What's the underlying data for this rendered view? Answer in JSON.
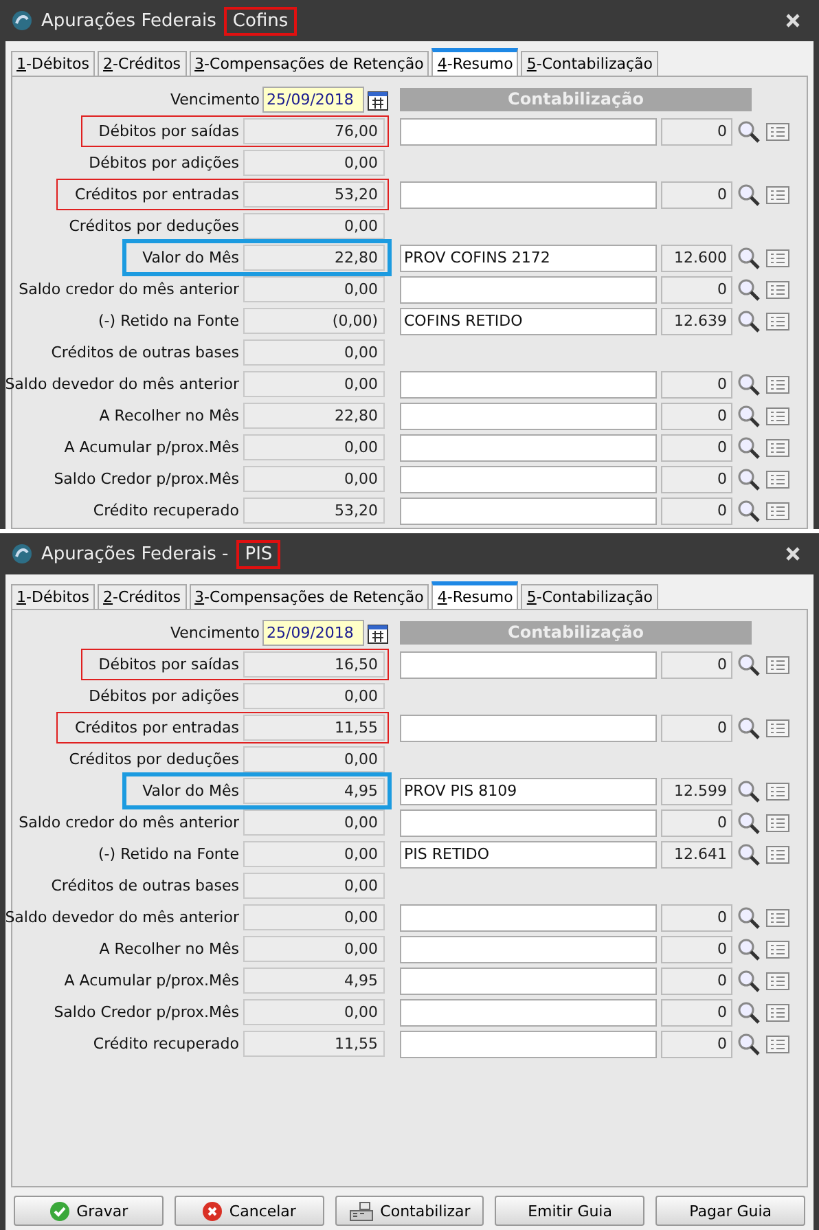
{
  "windows": [
    {
      "title": "Apurações Federais",
      "subject": "Cofins",
      "subject_marked": true,
      "tabs": [
        {
          "label": "1-Débitos",
          "selected": false
        },
        {
          "label": "2-Créditos",
          "selected": false
        },
        {
          "label": "3-Compensações de Retenção",
          "selected": false
        },
        {
          "label": "4-Resumo",
          "selected": true
        },
        {
          "label": "5-Contabilização",
          "selected": false
        }
      ],
      "due_label": "Vencimento",
      "due_date": "25/09/2018",
      "accounting_header": "Contabilização",
      "rows": [
        {
          "label": "Débitos por saídas",
          "value": "76,00",
          "kind": "marked",
          "account": "",
          "code": "0"
        },
        {
          "label": "Débitos por adições",
          "value": "0,00",
          "kind": "plain"
        },
        {
          "label": "Créditos por entradas",
          "value": "53,20",
          "kind": "marked",
          "account": "",
          "code": "0"
        },
        {
          "label": "Créditos por deduções",
          "value": "0,00",
          "kind": "plain"
        },
        {
          "label": "Valor do Mês",
          "value": "22,80",
          "kind": "current",
          "account": "PROV COFINS 2172",
          "code": "12.600"
        },
        {
          "label": "Saldo credor do mês anterior",
          "value": "0,00",
          "kind": "plain",
          "account": "",
          "code": "0"
        },
        {
          "label": "(-) Retido na Fonte",
          "value": "(0,00)",
          "kind": "plain",
          "account": "COFINS RETIDO",
          "code": "12.639"
        },
        {
          "label": "Créditos de outras bases",
          "value": "0,00",
          "kind": "plain"
        },
        {
          "label": "Saldo devedor do mês anterior",
          "value": "0,00",
          "kind": "plain",
          "account": "",
          "code": "0"
        },
        {
          "label": "A Recolher no Mês",
          "value": "22,80",
          "kind": "plain",
          "account": "",
          "code": "0"
        },
        {
          "label": "A Acumular p/prox.Mês",
          "value": "0,00",
          "kind": "plain",
          "account": "",
          "code": "0"
        },
        {
          "label": "Saldo Credor p/prox.Mês",
          "value": "0,00",
          "kind": "plain",
          "account": "",
          "code": "0"
        },
        {
          "label": "Crédito recuperado",
          "value": "53,20",
          "kind": "plain",
          "account": "",
          "code": "0"
        }
      ]
    },
    {
      "title": "Apurações Federais -",
      "subject": "PIS",
      "subject_marked": true,
      "tabs": [
        {
          "label": "1-Débitos",
          "selected": false
        },
        {
          "label": "2-Créditos",
          "selected": false
        },
        {
          "label": "3-Compensações de Retenção",
          "selected": false
        },
        {
          "label": "4-Resumo",
          "selected": true
        },
        {
          "label": "5-Contabilização",
          "selected": false
        }
      ],
      "due_label": "Vencimento",
      "due_date": "25/09/2018",
      "accounting_header": "Contabilização",
      "rows": [
        {
          "label": "Débitos por saídas",
          "value": "16,50",
          "kind": "marked",
          "account": "",
          "code": "0"
        },
        {
          "label": "Débitos por adições",
          "value": "0,00",
          "kind": "plain"
        },
        {
          "label": "Créditos por entradas",
          "value": "11,55",
          "kind": "marked",
          "account": "",
          "code": "0"
        },
        {
          "label": "Créditos por deduções",
          "value": "0,00",
          "kind": "plain"
        },
        {
          "label": "Valor do Mês",
          "value": "4,95",
          "kind": "current",
          "account": "PROV PIS 8109",
          "code": "12.599"
        },
        {
          "label": "Saldo credor do mês anterior",
          "value": "0,00",
          "kind": "plain",
          "account": "",
          "code": "0"
        },
        {
          "label": "(-) Retido na Fonte",
          "value": "0,00",
          "kind": "plain",
          "account": "PIS RETIDO",
          "code": "12.641"
        },
        {
          "label": "Créditos de outras bases",
          "value": "0,00",
          "kind": "plain"
        },
        {
          "label": "Saldo devedor do mês anterior",
          "value": "0,00",
          "kind": "plain",
          "account": "",
          "code": "0"
        },
        {
          "label": "A Recolher no Mês",
          "value": "0,00",
          "kind": "plain",
          "account": "",
          "code": "0"
        },
        {
          "label": "A Acumular p/prox.Mês",
          "value": "4,95",
          "kind": "plain",
          "account": "",
          "code": "0"
        },
        {
          "label": "Saldo Credor p/prox.Mês",
          "value": "0,00",
          "kind": "plain",
          "account": "",
          "code": "0"
        },
        {
          "label": "Crédito recuperado",
          "value": "11,55",
          "kind": "plain",
          "account": "",
          "code": "0"
        }
      ],
      "buttons": [
        {
          "label": "Gravar"
        },
        {
          "label": "Cancelar"
        },
        {
          "label": "Contabilizar"
        },
        {
          "label": "Emitir Guia"
        },
        {
          "label": "Pagar Guia"
        }
      ]
    }
  ]
}
